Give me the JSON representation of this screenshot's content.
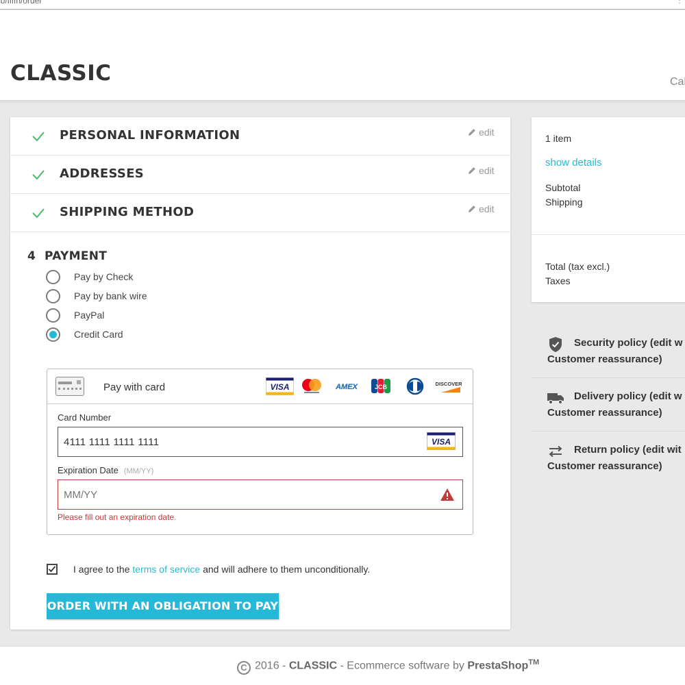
{
  "browser": {
    "url": "ub/ffffn/order",
    "menu": "⋮"
  },
  "header": {
    "logo": "CLASSIC",
    "cart_link": "Cal"
  },
  "steps": [
    {
      "title": "PERSONAL INFORMATION",
      "edit": "edit"
    },
    {
      "title": "ADDRESSES",
      "edit": "edit"
    },
    {
      "title": "SHIPPING METHOD",
      "edit": "edit"
    }
  ],
  "payment": {
    "number": "4",
    "title": "PAYMENT",
    "options": [
      {
        "label": "Pay by Check",
        "selected": false
      },
      {
        "label": "Pay by bank wire",
        "selected": false
      },
      {
        "label": "PayPal",
        "selected": false
      },
      {
        "label": "Credit Card",
        "selected": true
      }
    ],
    "card_form": {
      "title": "Pay with card",
      "brands": [
        "VISA",
        "MasterCard",
        "AMEX",
        "JCB",
        "Diners",
        "DISCOVER"
      ],
      "card_number_label": "Card Number",
      "card_number_value": "4111 1111 1111 1111",
      "detected_brand": "VISA",
      "expiration_label": "Expiration Date",
      "expiration_hint": "(MM/YY)",
      "expiration_placeholder": "MM/YY",
      "error_message": "Please fill out an expiration date."
    },
    "terms": {
      "prefix": "I agree to the ",
      "link": "terms of service",
      "suffix": " and will adhere to them unconditionally.",
      "checked": true
    },
    "order_button": "ORDER WITH AN OBLIGATION TO PAY"
  },
  "summary": {
    "items_count": "1 item",
    "show_details": "show details",
    "subtotal_label": "Subtotal",
    "shipping_label": "Shipping",
    "total_label": "Total (tax excl.)",
    "taxes_label": "Taxes"
  },
  "reassurance": [
    {
      "icon": "shield-icon",
      "title": "Security policy (edit w",
      "subtitle": "Customer reassurance)"
    },
    {
      "icon": "truck-icon",
      "title": "Delivery policy (edit w",
      "subtitle": "Customer reassurance)"
    },
    {
      "icon": "exchange-arrows-icon",
      "title": "Return policy (edit wit",
      "subtitle": "Customer reassurance)"
    }
  ],
  "footer": {
    "copyright_symbol": "C",
    "year": "2016 - ",
    "brand": "CLASSIC",
    "middle": " - Ecommerce software by ",
    "software": "PrestaShop",
    "tm": "TM"
  },
  "colors": {
    "accent": "#25b9d7",
    "check": "#4cbb6c",
    "error": "#c13b3b",
    "background": "#e9e9e9"
  }
}
